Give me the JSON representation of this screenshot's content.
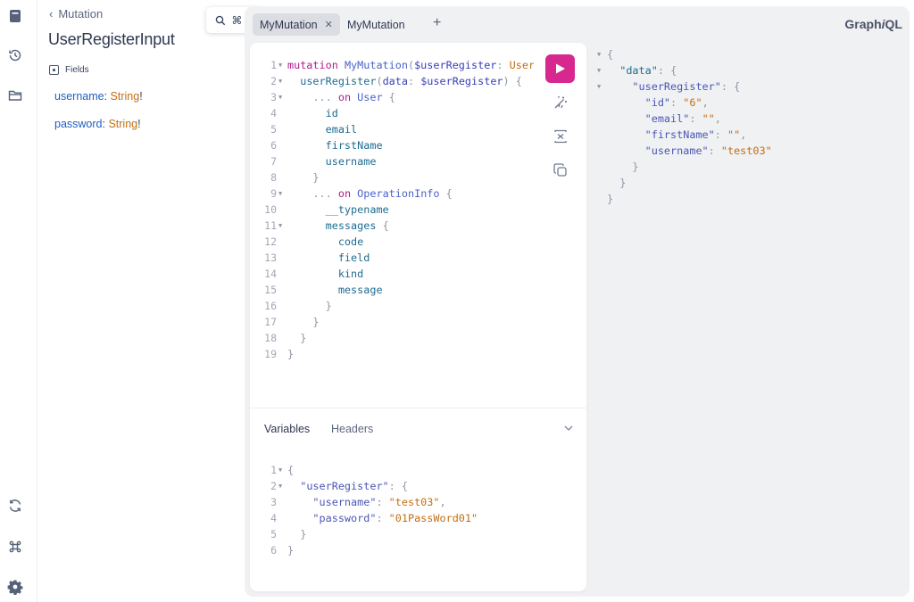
{
  "rail": {
    "icons": [
      "docs-book-icon",
      "history-icon",
      "folder-icon",
      "refetch-schema-icon",
      "keyboard-shortcuts-icon",
      "settings-gear-icon"
    ]
  },
  "docs": {
    "back_label": "Mutation",
    "title": "UserRegisterInput",
    "fields_heading": "Fields",
    "fields": [
      {
        "name": "username",
        "type": "String",
        "suffix": "!"
      },
      {
        "name": "password",
        "type": "String",
        "suffix": "!"
      }
    ],
    "search_shortcut": "⌘ K"
  },
  "tabs": [
    {
      "label": "MyMutation",
      "active": true,
      "closable": true
    },
    {
      "label": "MyMutation",
      "active": false,
      "closable": false
    }
  ],
  "brand": {
    "prefix": "Graph",
    "italic": "i",
    "suffix": "QL"
  },
  "editor": {
    "lines": [
      {
        "n": "1",
        "fold": true
      },
      {
        "n": "2",
        "fold": true
      },
      {
        "n": "3",
        "fold": true
      },
      {
        "n": "4"
      },
      {
        "n": "5"
      },
      {
        "n": "6"
      },
      {
        "n": "7"
      },
      {
        "n": "8"
      },
      {
        "n": "9",
        "fold": true
      },
      {
        "n": "10"
      },
      {
        "n": "11",
        "fold": true
      },
      {
        "n": "12"
      },
      {
        "n": "13"
      },
      {
        "n": "14"
      },
      {
        "n": "15"
      },
      {
        "n": "16"
      },
      {
        "n": "17"
      },
      {
        "n": "18"
      },
      {
        "n": "19"
      }
    ],
    "tokens": {
      "l1_kw": "mutation",
      "l1_name": "MyMutation",
      "l1_open": "(",
      "l1_var": "$userRegister",
      "l1_colon": ":",
      "l1_type": "User",
      "l2_field": "userRegister",
      "l2_open": "(",
      "l2_arg": "data",
      "l2_colon": ":",
      "l2_var": "$userRegister",
      "l2_close": ")",
      "l2_brace": "{",
      "l3_spread": "...",
      "l3_on": "on",
      "l3_type": "User",
      "l3_brace": "{",
      "l4": "id",
      "l5": "email",
      "l6": "firstName",
      "l7": "username",
      "l8": "}",
      "l9_spread": "...",
      "l9_on": "on",
      "l9_type": "OperationInfo",
      "l9_brace": "{",
      "l10": "__typename",
      "l11_field": "messages",
      "l11_brace": "{",
      "l12": "code",
      "l13": "field",
      "l14": "kind",
      "l15": "message",
      "l16": "}",
      "l17": "}",
      "l18": "}",
      "l19": "}"
    }
  },
  "variables_panel": {
    "tabs": [
      "Variables",
      "Headers"
    ],
    "active_tab": "Variables",
    "lines": [
      {
        "n": "1",
        "fold": true
      },
      {
        "n": "2",
        "fold": true
      },
      {
        "n": "3"
      },
      {
        "n": "4"
      },
      {
        "n": "5"
      },
      {
        "n": "6"
      }
    ],
    "tokens": {
      "v1": "{",
      "v2_key": "\"userRegister\"",
      "v2_colon": ":",
      "v2_brace": "{",
      "v3_key": "\"username\"",
      "v3_colon": ":",
      "v3_val": "\"test03\"",
      "v3_comma": ",",
      "v4_key": "\"password\"",
      "v4_colon": ":",
      "v4_val": "\"01PassWord01\"",
      "v5": "}",
      "v6": "}"
    }
  },
  "result": {
    "tokens": {
      "r1": "{",
      "r2_key": "\"data\"",
      "r2_colon": ":",
      "r2_brace": "{",
      "r3_key": "\"userRegister\"",
      "r3_colon": ":",
      "r3_brace": "{",
      "r4_key": "\"id\"",
      "r4_colon": ":",
      "r4_val": "\"6\"",
      "r4_comma": ",",
      "r5_key": "\"email\"",
      "r5_colon": ":",
      "r5_val": "\"\"",
      "r5_comma": ",",
      "r6_key": "\"firstName\"",
      "r6_colon": ":",
      "r6_val": "\"\"",
      "r6_comma": ",",
      "r7_key": "\"username\"",
      "r7_colon": ":",
      "r7_val": "\"test03\"",
      "r8": "}",
      "r9": "}",
      "r10": "}"
    }
  },
  "colors": {
    "execute": "#d6288f",
    "keyword": "#b11a8d",
    "type": "#c46e10"
  }
}
